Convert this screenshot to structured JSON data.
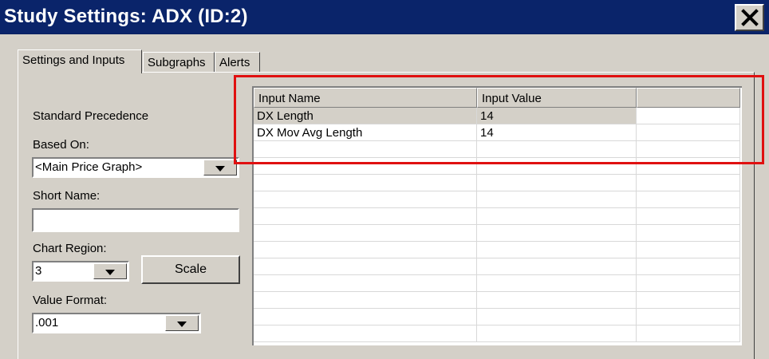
{
  "window": {
    "title": "Study Settings: ADX (ID:2)",
    "close_icon": "close-x-icon"
  },
  "tabs": [
    {
      "label": "Settings and Inputs",
      "active": true
    },
    {
      "label": "Subgraphs",
      "active": false
    },
    {
      "label": "Alerts",
      "active": false
    }
  ],
  "settings": {
    "precedence_label": "Standard Precedence",
    "based_on_label": "Based On:",
    "based_on_value": "<Main Price Graph>",
    "short_name_label": "Short Name:",
    "short_name_value": "",
    "chart_region_label": "Chart Region:",
    "chart_region_value": "3",
    "scale_button": "Scale",
    "value_format_label": "Value Format:",
    "value_format_value": ".001"
  },
  "inputs_table": {
    "columns": [
      "Input Name",
      "Input Value",
      ""
    ],
    "rows": [
      {
        "name": "DX Length",
        "value": "14"
      },
      {
        "name": "DX Mov Avg Length",
        "value": "14"
      }
    ],
    "empty_rows": 12
  },
  "colors": {
    "titlebar": "#0a246a",
    "dialog_bg": "#d4d0c8",
    "highlight": "#e01010"
  }
}
